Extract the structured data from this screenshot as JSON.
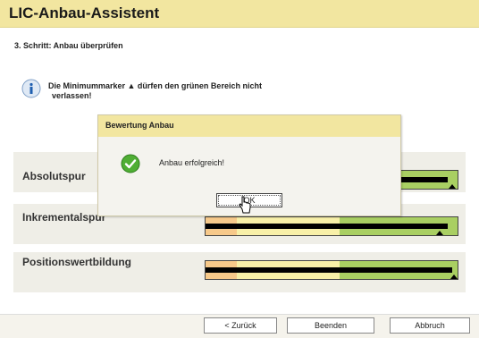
{
  "window": {
    "title": "LIC-Anbau-Assistent"
  },
  "step": "3. Schritt: Anbau überprüfen",
  "info": {
    "icon": "info-icon",
    "line1": "Die Minimummarker ▲ dürfen den grünen Bereich nicht",
    "line2": "verlassen!"
  },
  "sections": [
    {
      "label": "Absolutspur",
      "bar_fraction": 0.96
    },
    {
      "label": "Inkrementalspur",
      "bar_fraction": 0.96
    },
    {
      "label": "Positionswertbildung",
      "bar_fraction": 0.98
    }
  ],
  "colors": {
    "header": "#f2e6a0",
    "zone_orange": "#f7c98a",
    "zone_yellow": "#f8f0a8",
    "zone_green": "#a9cf62",
    "bar": "#000000"
  },
  "footer": {
    "back_label": "< Zurück",
    "finish_label": "Beenden",
    "cancel_label": "Abbruch"
  },
  "dialog": {
    "title": "Bewertung Anbau",
    "icon": "check-icon",
    "message": "Anbau erfolgreich!",
    "ok_label": "OK"
  }
}
